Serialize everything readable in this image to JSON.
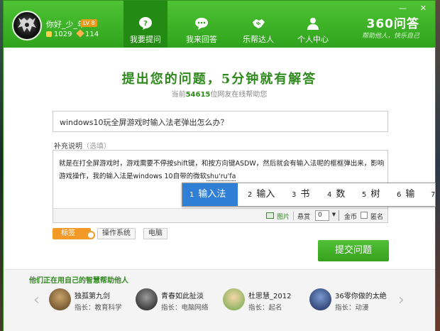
{
  "user": {
    "name": "你好_少_年",
    "level": "LV 8",
    "coins": "1029",
    "gems": "114"
  },
  "nav": [
    {
      "label": "我要提问",
      "icon": "question-bubble-icon"
    },
    {
      "label": "我来回答",
      "icon": "chat-bubble-icon"
    },
    {
      "label": "乐帮达人",
      "icon": "handshake-icon"
    },
    {
      "label": "个人中心",
      "icon": "person-icon"
    }
  ],
  "brand": {
    "name": "360问答",
    "slogan": "帮助他人，快乐自己"
  },
  "window_controls": [
    "—",
    "✕"
  ],
  "headline": "提出您的问题，5分钟就有解答",
  "online": {
    "prefix": "当前",
    "count": "54615",
    "suffix": "位网友在线帮助您"
  },
  "question": {
    "value": "windows10玩全屏游戏时输入法老弹出怎么办？"
  },
  "description": {
    "label": "补充说明",
    "optional": "（选填）",
    "text": "就是在打全屏游戏时，游戏需要不停按shift键，和按方向键ASDW，然后就会有输入法呢的框框弹出来，影响游戏操作，我的输入法是windows  10自带的微软",
    "ime_composition": "shu'ru'fa"
  },
  "toolbar": {
    "image_label": "图片",
    "reward_label": "悬赏",
    "reward_value": "0",
    "coin_label": "金币",
    "anonymous_label": "匿名"
  },
  "ime_candidates": [
    {
      "num": "1",
      "text": "输入法"
    },
    {
      "num": "2",
      "text": "输入"
    },
    {
      "num": "3",
      "text": "书"
    },
    {
      "num": "4",
      "text": "数"
    },
    {
      "num": "5",
      "text": "树"
    },
    {
      "num": "6",
      "text": "输"
    },
    {
      "num": "7",
      "text": ""
    }
  ],
  "tags": {
    "label": "标签",
    "items": [
      "操作系统",
      "电脑"
    ]
  },
  "submit_label": "提交问题",
  "helpers": {
    "title": "他们正在用自己的智慧帮助他人",
    "people": [
      {
        "name": "独孤第九剑",
        "role": "指长：教育科学"
      },
      {
        "name": "青春如此扯淡",
        "role": "指长：电脑网络"
      },
      {
        "name": "杜思慧_2012",
        "role": "指长：起名"
      },
      {
        "name": "36零你做的太绝",
        "role": "指长：动漫"
      }
    ]
  },
  "colors": {
    "accent": "#3bb224",
    "active_nav": "#238a13",
    "ime_highlight": "#2f7fd6",
    "tag_orange": "#f39a26"
  }
}
